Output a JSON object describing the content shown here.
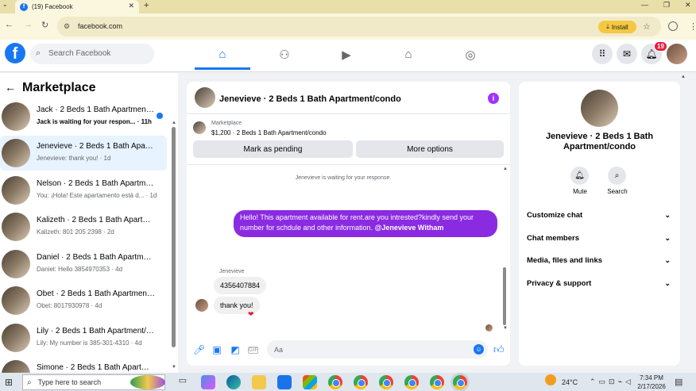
{
  "browser": {
    "tab_title": "(19) Facebook",
    "tab_favicon": "f",
    "new_tab": "+",
    "url": "facebook.com",
    "install_label": "Install"
  },
  "header": {
    "logo_letter": "f",
    "search_placeholder": "Search Facebook",
    "notif_count": "19",
    "nav_icons": [
      "home-icon",
      "friends-icon",
      "video-icon",
      "marketplace-icon",
      "groups-icon"
    ]
  },
  "sidebar": {
    "title": "Marketplace",
    "conversations": [
      {
        "name": "Jack · 2 Beds 1 Bath Apartment/condo",
        "preview": "Jack is waiting for your respon... · 11h",
        "unread": true
      },
      {
        "name": "Jenevieve · 2 Beds 1 Bath Apartment/condo",
        "preview": "Jenevieve: thank you! · 1d",
        "active": true
      },
      {
        "name": "Nelson · 2 Beds 1 Bath Apartment/condo",
        "preview": "You: ¡Hola! Este apartamento está d... · 1d"
      },
      {
        "name": "Kalizeth · 2 Beds 1 Bath Apartment/condo",
        "preview": "Kalizeth: 801 205 2398 · 2d"
      },
      {
        "name": "Daniel · 2 Beds 1 Bath Apartment/condo",
        "preview": "Daniel: Hello 3854970353 · 4d"
      },
      {
        "name": "Obet · 2 Beds 1 Bath Apartment/condo",
        "preview": "Obet: 8017930978 · 4d"
      },
      {
        "name": "Lily · 2 Beds 1 Bath Apartment/condo",
        "preview": "Lily: My number is 385-301-4310 · 4d"
      },
      {
        "name": "Simone · 2 Beds 1 Bath Apartment/condo",
        "preview": ""
      }
    ]
  },
  "chat": {
    "title": "Jenevieve · 2 Beds 1 Bath Apartment/condo",
    "marketplace_label": "Marketplace",
    "listing": "$1,200 · 2 Beds 1 Bath Apartment/condo",
    "mark_pending": "Mark as pending",
    "more_options": "More options",
    "waiting_text": "Jenevieve is waiting for your response.",
    "outgoing_message": "Hello! This apartment available for rent.are you intrested?kindly send your number for schdule and other information.",
    "outgoing_mention": "@Jenevieve Witham",
    "sender_label": "Jenevieve",
    "incoming_1": "4356407884",
    "incoming_2": "thank you!",
    "reaction": "❤",
    "compose_placeholder": "Aa",
    "gif_label": "GIF"
  },
  "right_panel": {
    "name": "Jenevieve · 2 Beds 1 Bath Apartment/condo",
    "mute_label": "Mute",
    "search_label": "Search",
    "rows": [
      "Customize chat",
      "Chat members",
      "Media, files and links",
      "Privacy & support"
    ]
  },
  "taskbar": {
    "search_placeholder": "Type here to search",
    "temperature": "24°C",
    "time": "7:34 PM",
    "date": "2/17/2026"
  },
  "colors": {
    "brand_blue": "#1877f2",
    "message_purple": "#8a2be2",
    "badge_red": "#e41e3f"
  }
}
